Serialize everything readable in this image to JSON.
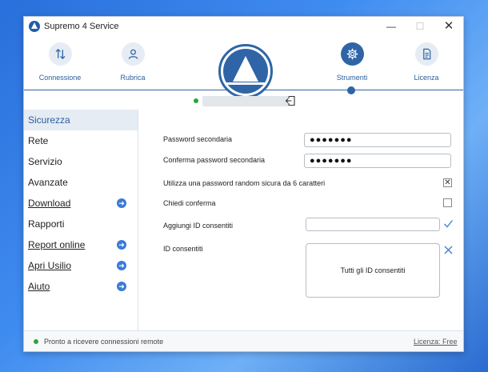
{
  "window": {
    "title": "Supremo 4 Service"
  },
  "titlebar": {
    "min": "—",
    "max": "☐",
    "close": "✕"
  },
  "toolbar": {
    "connessione": "Connessione",
    "rubrica": "Rubrica",
    "strumenti": "Strumenti",
    "licenza": "Licenza",
    "active": "Strumenti"
  },
  "colors": {
    "accent": "#2f65a7",
    "link": "#2a5d9f",
    "online": "#2aa63a"
  },
  "sidebar": {
    "items": [
      {
        "label": "Sicurezza",
        "active": true,
        "link": false
      },
      {
        "label": "Rete",
        "active": false,
        "link": false
      },
      {
        "label": "Servizio",
        "active": false,
        "link": false
      },
      {
        "label": "Avanzate",
        "active": false,
        "link": false
      },
      {
        "label": "Download",
        "active": false,
        "link": true,
        "icon": "arrow-right-icon"
      },
      {
        "label": "Rapporti",
        "active": false,
        "link": false
      },
      {
        "label": "Report online",
        "active": false,
        "link": true,
        "icon": "arrow-right-icon"
      },
      {
        "label": "Apri Usilio",
        "active": false,
        "link": true,
        "icon": "arrow-right-icon"
      },
      {
        "label": "Aiuto",
        "active": false,
        "link": true,
        "icon": "arrow-right-icon"
      }
    ]
  },
  "security": {
    "secondary_password_label": "Password secondaria",
    "secondary_password_value": "●●●●●●●",
    "confirm_password_label": "Conferma password secondaria",
    "confirm_password_value": "●●●●●●●",
    "random_password_label": "Utilizza una password random sicura da 6 caratteri",
    "random_password_checked": true,
    "ask_confirm_label": "Chiedi conferma",
    "ask_confirm_checked": false,
    "add_ids_label": "Aggiungi ID consentiti",
    "add_ids_value": "",
    "allowed_ids_label": "ID consentiti",
    "allowed_ids_content": "Tutti gli ID consentiti"
  },
  "statusbar": {
    "text": "Pronto a ricevere connessioni remote",
    "license": "Licenza: Free"
  }
}
